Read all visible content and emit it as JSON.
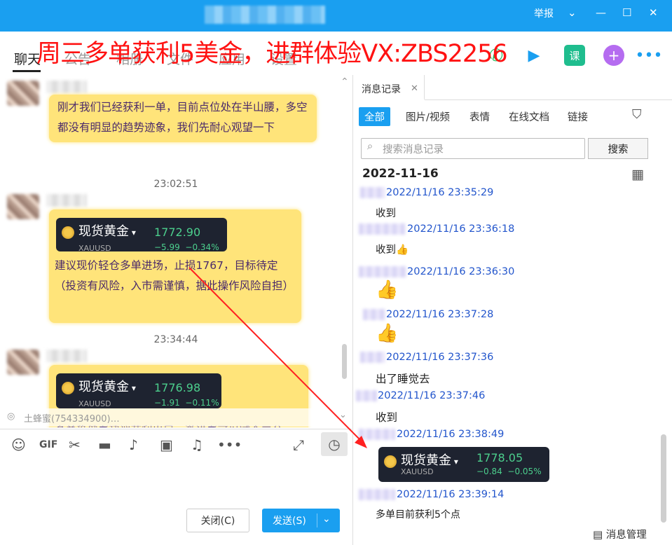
{
  "titlebar": {
    "report_label": "举报",
    "controls": [
      "chevron-down",
      "minimize",
      "maximize",
      "close"
    ]
  },
  "overlay_text": "周三多单获利5美金，进群体验VX:ZBS2256",
  "tabs": [
    {
      "label": "聊天",
      "active": true
    },
    {
      "label": "公告",
      "active": false
    },
    {
      "label": "相册",
      "active": false
    },
    {
      "label": "文件",
      "active": false
    },
    {
      "label": "应用",
      "active": false
    },
    {
      "label": "设置",
      "active": false
    }
  ],
  "header_icons": {
    "lesson_label": "课"
  },
  "chat": {
    "messages": [
      {
        "text": "刚才我们已经获利一单，目前点位处在半山腰，多空都没有明显的趋势迹象，我们先耐心观望一下"
      },
      {
        "time": "23:02:51"
      },
      {
        "card": {
          "name": "现货黄金",
          "symbol": "XAUUSD",
          "price": "1772.90",
          "change": "−5.99",
          "pct": "−0.34%"
        },
        "text": "建议现价轻仓多单进场，止损1767，目标待定（投资有风险，入市需谨慎，据此操作风险自担）"
      },
      {
        "time": "23:34:44"
      },
      {
        "card": {
          "name": "现货黄金",
          "symbol": "XAUUSD",
          "price": "1776.98",
          "change": "−1.91",
          "pct": "−0.11%"
        },
        "text": "多单稳健者建议获利出局，激进者可以减仓三分"
      }
    ],
    "notice_text": "土蜂蜜(754334900)…",
    "toolbar_icons": [
      "emoji-icon",
      "gif-icon",
      "scissors-icon",
      "folder-icon",
      "voice-icon",
      "image-icon",
      "bell-icon",
      "more-icon",
      "expand-icon",
      "history-icon"
    ],
    "close_label": "关闭(C)",
    "send_label": "发送(S)"
  },
  "history": {
    "tab_label": "消息记录",
    "filters": [
      "全部",
      "图片/视频",
      "表情",
      "在线文档",
      "链接"
    ],
    "search_placeholder": "搜索消息记录",
    "search_button": "搜索",
    "date": "2022-11-16",
    "entries": [
      {
        "time": "2022/11/16 23:35:29",
        "text": "收到"
      },
      {
        "time": "2022/11/16 23:36:18",
        "text": "收到👍"
      },
      {
        "time": "2022/11/16 23:36:30",
        "text": "👍"
      },
      {
        "time": "2022/11/16 23:37:28",
        "text": "👍"
      },
      {
        "time": "2022/11/16 23:37:36",
        "text": "出了睡觉去"
      },
      {
        "time": "2022/11/16 23:37:46",
        "text": "收到"
      },
      {
        "time": "2022/11/16 23:38:49",
        "card": {
          "name": "现货黄金",
          "symbol": "XAUUSD",
          "price": "1778.05",
          "change": "−0.84",
          "pct": "−0.05%"
        }
      },
      {
        "time": "2022/11/16 23:39:14",
        "text": "多单目前获利5个点"
      }
    ],
    "manage_label": "消息管理"
  },
  "colors": {
    "titlebar": "#1a9ff0",
    "bubble": "#ffe47a",
    "overlay_text": "#ff1212",
    "timestamp_link": "#2255cc",
    "card_bg": "#1e2330",
    "card_green": "#4ccf8d"
  }
}
